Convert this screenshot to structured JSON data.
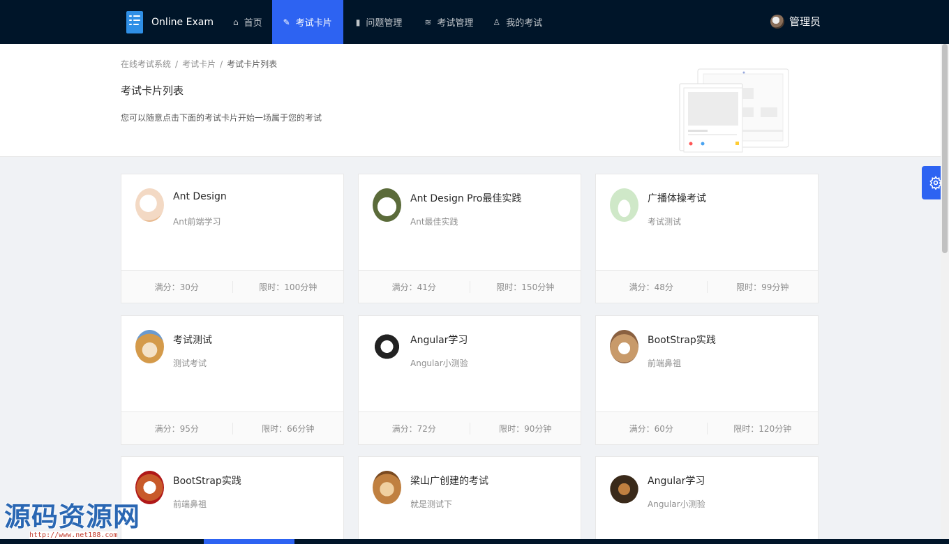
{
  "header": {
    "logo_text": "Online Exam",
    "nav": [
      {
        "label": "首页",
        "icon": "home-icon",
        "active": false
      },
      {
        "label": "考试卡片",
        "icon": "card-icon",
        "active": true
      },
      {
        "label": "问题管理",
        "icon": "book-icon",
        "active": false
      },
      {
        "label": "考试管理",
        "icon": "stack-icon",
        "active": false
      },
      {
        "label": "我的考试",
        "icon": "user-icon",
        "active": false
      }
    ],
    "user_name": "管理员"
  },
  "page": {
    "breadcrumb": [
      "在线考试系统",
      "考试卡片",
      "考试卡片列表"
    ],
    "title": "考试卡片列表",
    "description": "您可以随意点击下面的考试卡片开始一场属于您的考试"
  },
  "cards": [
    {
      "title": "Ant Design",
      "desc": "Ant前端学习",
      "score": "满分：30分",
      "time": "限时：100分钟",
      "avatar_color": "#f3d9c4"
    },
    {
      "title": "Ant Design Pro最佳实践",
      "desc": "Ant最佳实践",
      "score": "满分：41分",
      "time": "限时：150分钟",
      "avatar_color": "#5b6b3a"
    },
    {
      "title": "广播体操考试",
      "desc": "考试测试",
      "score": "满分：48分",
      "time": "限时：99分钟",
      "avatar_color": "#cfe8c8"
    },
    {
      "title": "考试测试",
      "desc": "测试考试",
      "score": "满分：95分",
      "time": "限时：66分钟",
      "avatar_color": "#d49a4a"
    },
    {
      "title": "Angular学习",
      "desc": "Angular小测验",
      "score": "满分：72分",
      "time": "限时：90分钟",
      "avatar_color": "#e8e8e8"
    },
    {
      "title": "BootStrap实践",
      "desc": "前端鼻祖",
      "score": "满分：60分",
      "time": "限时：120分钟",
      "avatar_color": "#c89a6a"
    },
    {
      "title": "BootStrap实践",
      "desc": "前端鼻祖",
      "score": "",
      "time": "",
      "avatar_color": "#c85a2a"
    },
    {
      "title": "梁山广创建的考试",
      "desc": "就是测试下",
      "score": "",
      "time": "",
      "avatar_color": "#c08040"
    },
    {
      "title": "Angular学习",
      "desc": "Angular小测验",
      "score": "",
      "time": "",
      "avatar_color": "#3a2a1a"
    }
  ],
  "watermark": {
    "text": "源码资源网",
    "url": "http://www.net188.com"
  },
  "colors": {
    "header_bg": "#001529",
    "accent": "#2d63f2"
  }
}
